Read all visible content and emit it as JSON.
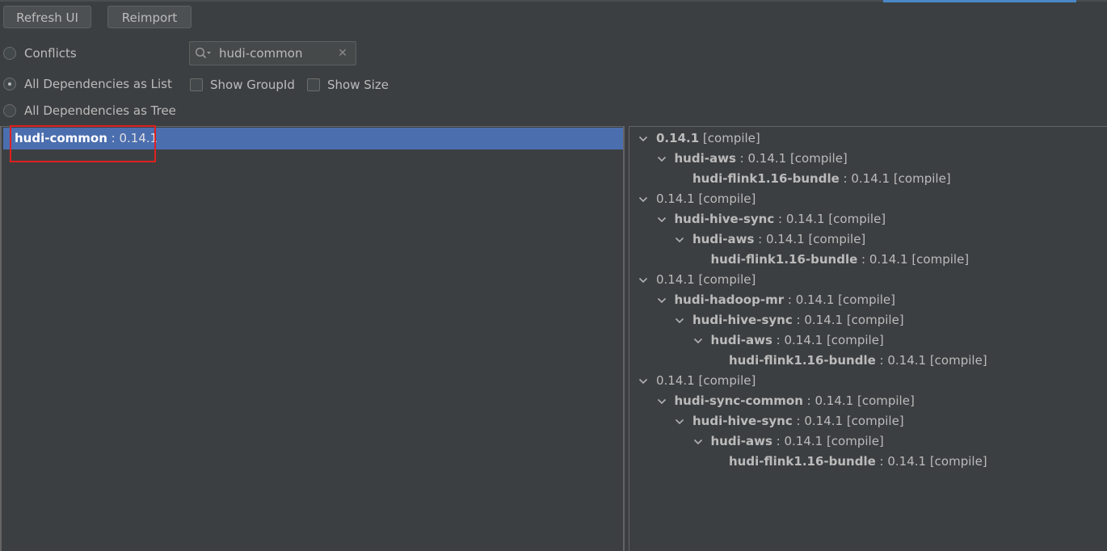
{
  "toolbar": {
    "refresh_label": "Refresh UI",
    "reimport_label": "Reimport"
  },
  "modes": {
    "conflicts_label": "Conflicts",
    "list_label": "All Dependencies as List",
    "tree_label": "All Dependencies as Tree",
    "selected": "All Dependencies as List"
  },
  "options": {
    "show_groupid_label": "Show GroupId",
    "show_size_label": "Show Size",
    "show_groupid_checked": false,
    "show_size_checked": false
  },
  "search": {
    "value": "hudi-common"
  },
  "left_list": {
    "items": [
      {
        "name": "hudi-common",
        "version": " : 0.14.1"
      }
    ]
  },
  "right_tree": {
    "nodes": [
      {
        "name": "0.14.1",
        "suffix": " [compile]",
        "bold": true
      },
      {
        "name": "hudi-aws",
        "suffix": " : 0.14.1 [compile]",
        "bold": true
      },
      {
        "name": "hudi-flink1.16-bundle",
        "suffix": " : 0.14.1 [compile]",
        "bold": true
      },
      {
        "name": "0.14.1",
        "suffix": " [compile]",
        "bold": false
      },
      {
        "name": "hudi-hive-sync",
        "suffix": " : 0.14.1 [compile]",
        "bold": true
      },
      {
        "name": "hudi-aws",
        "suffix": " : 0.14.1 [compile]",
        "bold": true
      },
      {
        "name": "hudi-flink1.16-bundle",
        "suffix": " : 0.14.1 [compile]",
        "bold": true
      },
      {
        "name": "0.14.1",
        "suffix": " [compile]",
        "bold": false
      },
      {
        "name": "hudi-hadoop-mr",
        "suffix": " : 0.14.1 [compile]",
        "bold": true
      },
      {
        "name": "hudi-hive-sync",
        "suffix": " : 0.14.1 [compile]",
        "bold": true
      },
      {
        "name": "hudi-aws",
        "suffix": " : 0.14.1 [compile]",
        "bold": true
      },
      {
        "name": "hudi-flink1.16-bundle",
        "suffix": " : 0.14.1 [compile]",
        "bold": true
      },
      {
        "name": "0.14.1",
        "suffix": " [compile]",
        "bold": false
      },
      {
        "name": "hudi-sync-common",
        "suffix": " : 0.14.1 [compile]",
        "bold": true
      },
      {
        "name": "hudi-hive-sync",
        "suffix": " : 0.14.1 [compile]",
        "bold": true
      },
      {
        "name": "hudi-aws",
        "suffix": " : 0.14.1 [compile]",
        "bold": true
      },
      {
        "name": "hudi-flink1.16-bundle",
        "suffix": " : 0.14.1 [compile]",
        "bold": true
      }
    ]
  },
  "colors": {
    "background": "#3c3f41",
    "selection": "#4b6eaf",
    "highlight_box": "#e02020",
    "text": "#bbbbbb"
  }
}
